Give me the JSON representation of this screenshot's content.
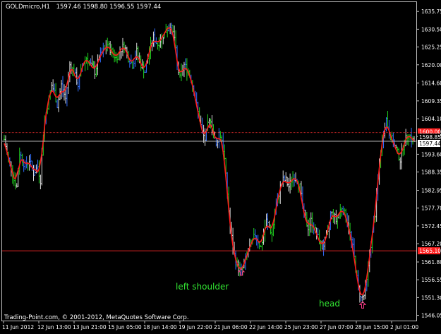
{
  "header": {
    "symbol": "GOLDmicro,H1",
    "ohlc": "1597.46 1598.80 1596.55 1597.44"
  },
  "footer": {
    "copyright": "Trading-Point.com, © 2001-2012, MetaQuotes Software Corp."
  },
  "annotations": {
    "left_shoulder": "left shoulder",
    "head": "head"
  },
  "colors": {
    "background": "#000000",
    "frame": "#c0c0c0",
    "axis_text": "#ffffff",
    "bar_green": "#1fd31f",
    "bar_blue": "#2f6dff",
    "bar_white": "#dcdcdc",
    "ma_red": "#ff1a1a",
    "resistance_line": "#ff3030",
    "support_line": "#ff2a2a",
    "price_line": "#b0b0b0",
    "annotation_text": "#32e632",
    "marker_arrow": "#ff3b8a"
  },
  "price_badges": {
    "resistance": "1600.00",
    "current": "1597.44",
    "support": "1565.10",
    "extra": "1598.85"
  },
  "chart_data": {
    "type": "bar",
    "instrument": "GOLDmicro",
    "timeframe": "H1",
    "price_ticks": [
      "1635.75",
      "1630.50",
      "1625.25",
      "1620.00",
      "1614.60",
      "1609.35",
      "1604.10",
      "1598.85",
      "1593.60",
      "1588.35",
      "1582.95",
      "1577.70",
      "1572.45",
      "1567.20",
      "1561.80",
      "1556.55",
      "1551.30",
      "1546.05"
    ],
    "price_tick_values": [
      1635.75,
      1630.5,
      1625.25,
      1620.0,
      1614.6,
      1609.35,
      1604.1,
      1598.85,
      1593.6,
      1588.35,
      1582.95,
      1577.7,
      1572.45,
      1567.2,
      1561.8,
      1556.55,
      1551.3,
      1546.05
    ],
    "time_ticks": [
      "11 Jun 2012",
      "12 Jun 13:00",
      "13 Jun 21:00",
      "15 Jun 05:00",
      "18 Jun 14:00",
      "19 Jun 22:00",
      "21 Jun 06:00",
      "22 Jun 14:00",
      "25 Jun 23:00",
      "27 Jun 07:00",
      "28 Jun 15:00",
      "2 Jul 01:00"
    ],
    "ylim": [
      1544.5,
      1638.5
    ],
    "horizontal_lines": {
      "resistance": 1600.0,
      "current_price": 1597.44,
      "support": 1565.1
    },
    "close_path_anchors": [
      [
        0,
        1598
      ],
      [
        6,
        1592
      ],
      [
        10,
        1590
      ],
      [
        14,
        1586
      ],
      [
        18,
        1584
      ],
      [
        22,
        1594
      ],
      [
        26,
        1592
      ],
      [
        30,
        1590
      ],
      [
        36,
        1592
      ],
      [
        42,
        1588
      ],
      [
        48,
        1590
      ],
      [
        52,
        1586
      ],
      [
        56,
        1600
      ],
      [
        60,
        1606
      ],
      [
        64,
        1610
      ],
      [
        68,
        1614
      ],
      [
        72,
        1612
      ],
      [
        76,
        1608
      ],
      [
        82,
        1614
      ],
      [
        88,
        1610
      ],
      [
        94,
        1620
      ],
      [
        100,
        1618
      ],
      [
        106,
        1614
      ],
      [
        112,
        1620
      ],
      [
        118,
        1622
      ],
      [
        124,
        1620
      ],
      [
        130,
        1618
      ],
      [
        136,
        1622
      ],
      [
        142,
        1624
      ],
      [
        148,
        1626
      ],
      [
        154,
        1624
      ],
      [
        160,
        1622
      ],
      [
        166,
        1624
      ],
      [
        172,
        1626
      ],
      [
        178,
        1622
      ],
      [
        184,
        1620
      ],
      [
        190,
        1624
      ],
      [
        196,
        1620
      ],
      [
        202,
        1618
      ],
      [
        208,
        1624
      ],
      [
        214,
        1628
      ],
      [
        220,
        1626
      ],
      [
        226,
        1628
      ],
      [
        232,
        1630
      ],
      [
        238,
        1632
      ],
      [
        244,
        1628
      ],
      [
        248,
        1620
      ],
      [
        252,
        1616
      ],
      [
        258,
        1620
      ],
      [
        264,
        1618
      ],
      [
        268,
        1616
      ],
      [
        272,
        1612
      ],
      [
        276,
        1608
      ],
      [
        280,
        1604
      ],
      [
        284,
        1600
      ],
      [
        288,
        1598
      ],
      [
        292,
        1602
      ],
      [
        296,
        1604
      ],
      [
        300,
        1600
      ],
      [
        304,
        1596
      ],
      [
        308,
        1600
      ],
      [
        312,
        1598
      ],
      [
        316,
        1592
      ],
      [
        320,
        1582
      ],
      [
        324,
        1572
      ],
      [
        328,
        1566
      ],
      [
        332,
        1562
      ],
      [
        336,
        1560
      ],
      [
        340,
        1559
      ],
      [
        344,
        1561
      ],
      [
        348,
        1564
      ],
      [
        352,
        1566
      ],
      [
        356,
        1568
      ],
      [
        360,
        1570
      ],
      [
        364,
        1568
      ],
      [
        368,
        1566
      ],
      [
        372,
        1570
      ],
      [
        376,
        1574
      ],
      [
        380,
        1572
      ],
      [
        384,
        1570
      ],
      [
        388,
        1576
      ],
      [
        392,
        1580
      ],
      [
        396,
        1584
      ],
      [
        400,
        1586
      ],
      [
        404,
        1586
      ],
      [
        408,
        1584
      ],
      [
        412,
        1586
      ],
      [
        416,
        1587
      ],
      [
        420,
        1586
      ],
      [
        424,
        1584
      ],
      [
        428,
        1578
      ],
      [
        432,
        1574
      ],
      [
        436,
        1572
      ],
      [
        440,
        1574
      ],
      [
        444,
        1572
      ],
      [
        448,
        1570
      ],
      [
        452,
        1568
      ],
      [
        456,
        1566
      ],
      [
        460,
        1568
      ],
      [
        464,
        1570
      ],
      [
        468,
        1576
      ],
      [
        472,
        1576
      ],
      [
        476,
        1574
      ],
      [
        480,
        1576
      ],
      [
        484,
        1578
      ],
      [
        488,
        1576
      ],
      [
        492,
        1574
      ],
      [
        496,
        1570
      ],
      [
        500,
        1566
      ],
      [
        504,
        1560
      ],
      [
        508,
        1554
      ],
      [
        512,
        1551
      ],
      [
        516,
        1552
      ],
      [
        520,
        1556
      ],
      [
        524,
        1564
      ],
      [
        528,
        1570
      ],
      [
        532,
        1576
      ],
      [
        536,
        1586
      ],
      [
        540,
        1594
      ],
      [
        544,
        1600
      ],
      [
        548,
        1604
      ],
      [
        552,
        1600
      ],
      [
        556,
        1598
      ],
      [
        560,
        1596
      ],
      [
        564,
        1594
      ],
      [
        568,
        1592
      ],
      [
        572,
        1596
      ],
      [
        576,
        1598
      ],
      [
        580,
        1600
      ],
      [
        584,
        1598
      ],
      [
        588,
        1597.44
      ]
    ],
    "markers": [
      {
        "label": "left shoulder",
        "price": 1558.5
      },
      {
        "label": "head",
        "price": 1548.8
      }
    ],
    "grid": false
  }
}
